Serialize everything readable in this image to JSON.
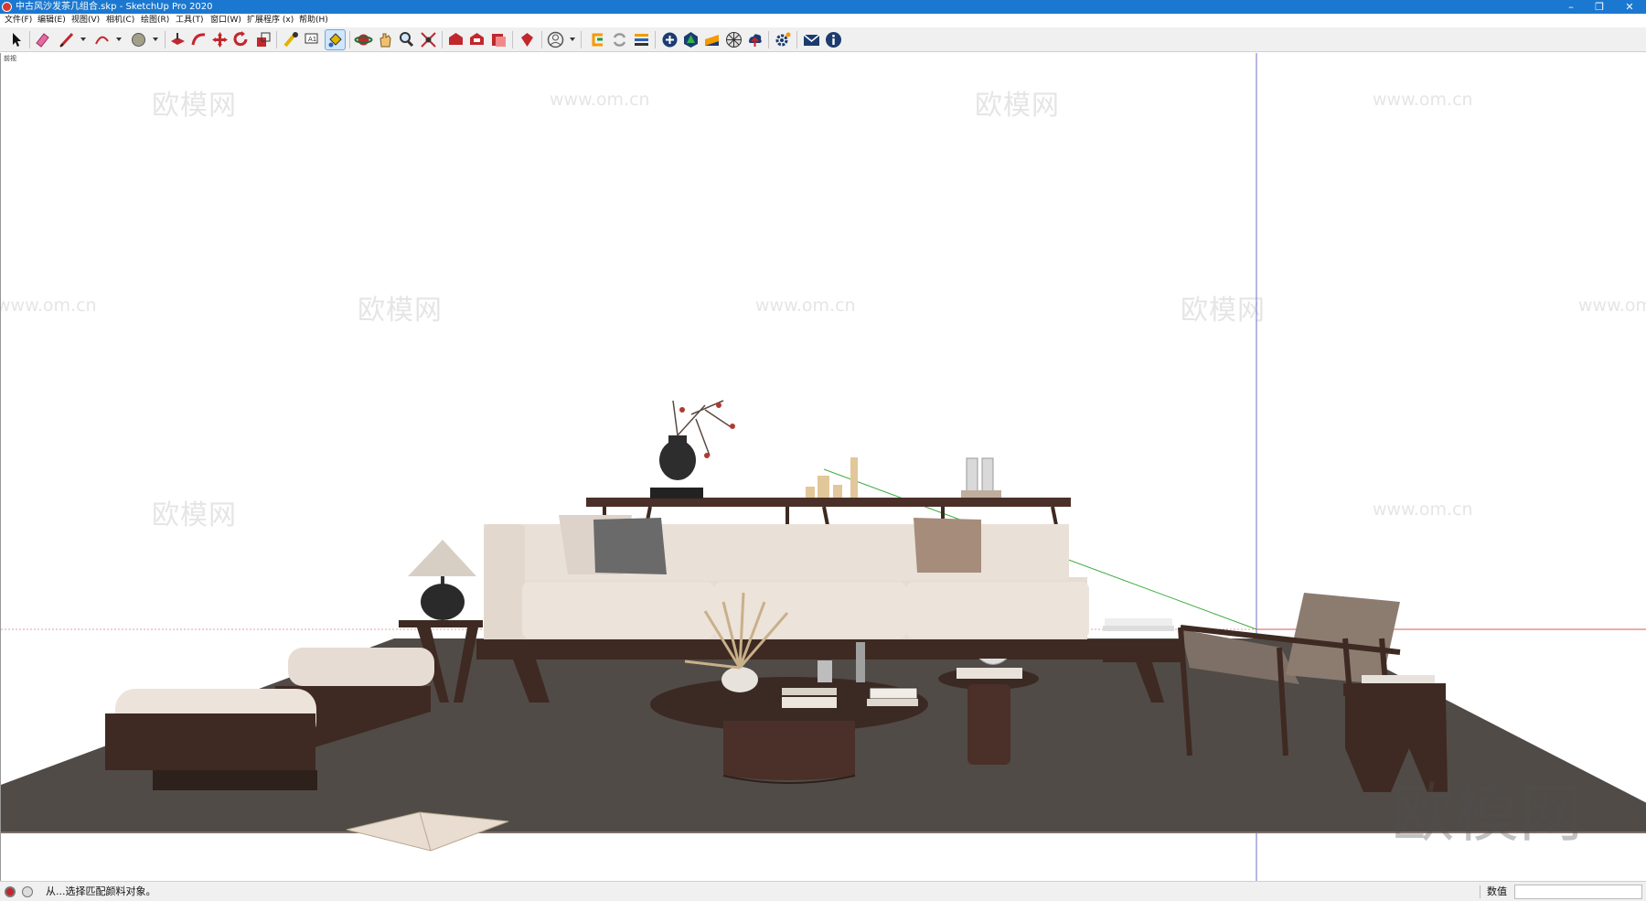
{
  "window": {
    "title": "中古风沙发茶几组合.skp - SketchUp Pro 2020",
    "controls": {
      "minimize": "–",
      "restore": "❐",
      "close": "✕"
    }
  },
  "menu": [
    "文件(F)",
    "编辑(E)",
    "视图(V)",
    "相机(C)",
    "绘图(R)",
    "工具(T)",
    "窗口(W)",
    "扩展程序 (x)",
    "帮助(H)"
  ],
  "toolbar": {
    "tools": [
      "select-tool",
      "eraser-tool",
      "line-tool",
      "arc-tool",
      "shapes-tool",
      "push-pull-tool",
      "follow-me-tool",
      "move-tool",
      "rotate-tool",
      "scale-tool",
      "tape-measure-tool",
      "text-tool",
      "paint-bucket-tool",
      "orbit-tool",
      "pan-tool",
      "zoom-tool",
      "zoom-extents-tool",
      "warehouse-tool",
      "extension-warehouse-tool",
      "layout-tool",
      "ruby-tool",
      "user-account-tool",
      "extension-tool-1",
      "extension-tool-2",
      "extension-tool-3",
      "extension-tool-4",
      "extension-tool-5",
      "extension-tool-6",
      "extension-tool-7",
      "extension-tool-8",
      "settings-tool",
      "mail-tool",
      "info-tool"
    ],
    "active_tool": "paint-bucket-tool",
    "accent": "#1b78d0"
  },
  "viewport": {
    "scene_label": "前视",
    "watermark_cn": "欧模网",
    "watermark_url": "www.om.cn",
    "colors": {
      "rug": "#4f4a46",
      "wood": "#3e2a22",
      "fabric": "#e6dcd3",
      "red_axis": "#d65a5a",
      "green_axis": "#3fae3f",
      "blue_axis": "#5a5ad6"
    }
  },
  "status": {
    "message": "从...选择匹配颜料对象。",
    "measurements_label": "数值",
    "measurements_value": ""
  }
}
